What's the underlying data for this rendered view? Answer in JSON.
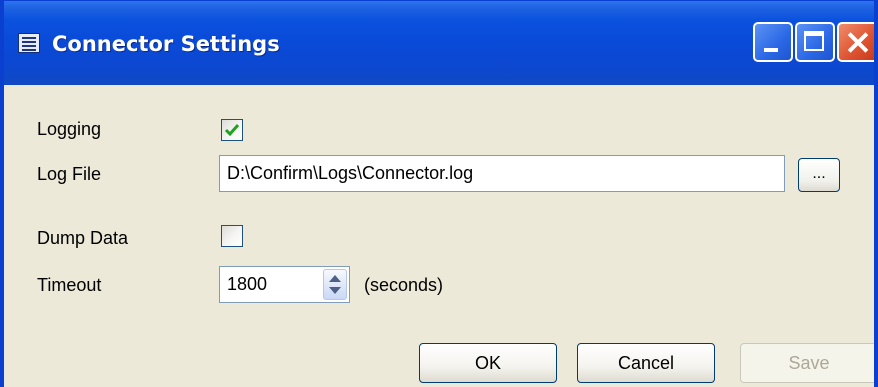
{
  "window": {
    "title": "Connector Settings",
    "title_icon": "list-window-icon",
    "controls": [
      "minimize-icon",
      "maximize-icon",
      "close-icon"
    ]
  },
  "form": {
    "logging": {
      "label": "Logging",
      "checked": true
    },
    "log_file": {
      "label": "Log File",
      "value": "D:\\Confirm\\Logs\\Connector.log",
      "browse_label": "..."
    },
    "dump_data": {
      "label": "Dump Data",
      "checked": false
    },
    "timeout": {
      "label": "Timeout",
      "value": "1800",
      "unit": "(seconds)"
    }
  },
  "buttons": {
    "ok": "OK",
    "cancel": "Cancel",
    "save": "Save",
    "save_enabled": false
  },
  "colors": {
    "titlebar": "#0a4ad8",
    "window_bg": "#ece9d8",
    "close_button": "#df5533",
    "checkmark": "#21a121",
    "disabled_text": "#aca899"
  }
}
